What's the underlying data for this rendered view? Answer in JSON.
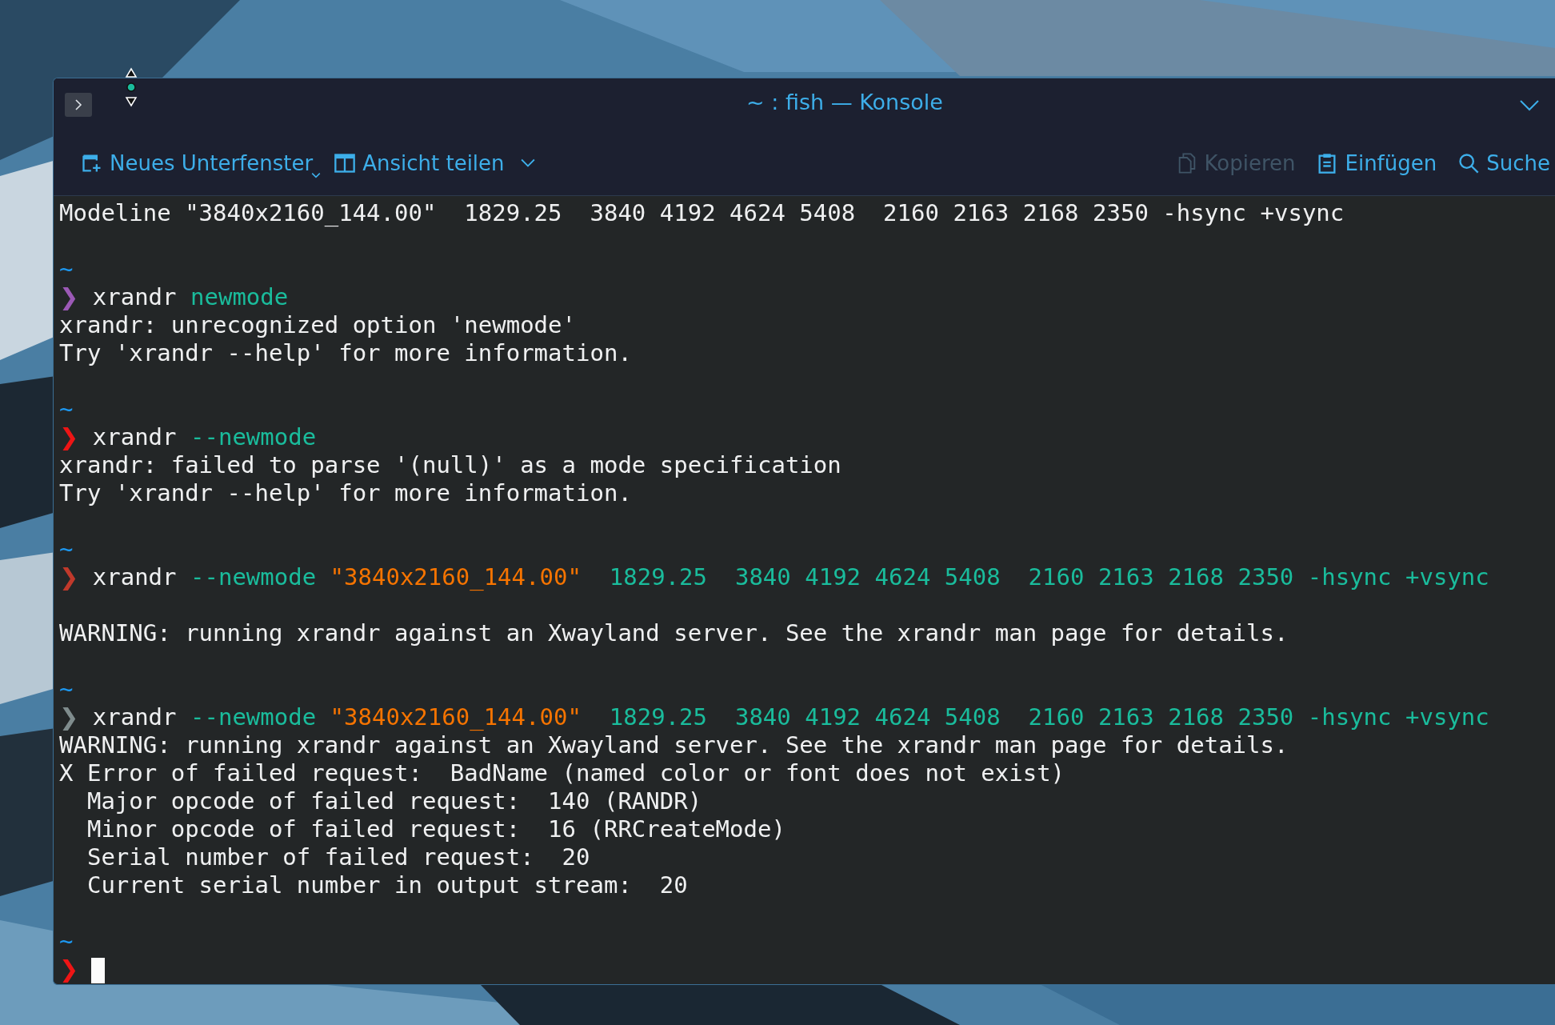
{
  "window": {
    "title": "~ : fish — Konsole"
  },
  "toolbar_left": [
    {
      "kind": "new-tab",
      "label": "Neues Unterfenster",
      "disabled": false,
      "menu": true
    },
    {
      "kind": "split",
      "label": "Ansicht teilen",
      "disabled": false,
      "menu": true
    }
  ],
  "toolbar_right": [
    {
      "kind": "copy",
      "label": "Kopieren",
      "disabled": true
    },
    {
      "kind": "paste",
      "label": "Einfügen",
      "disabled": false
    },
    {
      "kind": "search",
      "label": "Suche",
      "disabled": false
    }
  ],
  "terminal": {
    "lines": [
      {
        "kind": "text",
        "segments": [
          {
            "kind": "plain",
            "text": "Modeline \"3840x2160_144.00\"  1829.25  3840 4192 4624 5408  2160 2163 2168 2350 -hsync +vsync"
          }
        ]
      },
      {
        "kind": "blank"
      },
      {
        "kind": "text",
        "segments": [
          {
            "kind": "tilde",
            "text": "~"
          }
        ]
      },
      {
        "kind": "text",
        "segments": [
          {
            "kind": "prompt",
            "text": "❯",
            "color": "#9b59b6"
          },
          {
            "kind": "plain",
            "text": " xrandr "
          },
          {
            "kind": "arg",
            "text": "newmode"
          }
        ]
      },
      {
        "kind": "text",
        "segments": [
          {
            "kind": "plain",
            "text": "xrandr: unrecognized option 'newmode'"
          }
        ]
      },
      {
        "kind": "text",
        "segments": [
          {
            "kind": "plain",
            "text": "Try 'xrandr --help' for more information."
          }
        ]
      },
      {
        "kind": "blank"
      },
      {
        "kind": "text",
        "segments": [
          {
            "kind": "tilde",
            "text": "~"
          }
        ]
      },
      {
        "kind": "text",
        "segments": [
          {
            "kind": "prompt",
            "text": "❯",
            "color": "#ed1515"
          },
          {
            "kind": "plain",
            "text": " xrandr "
          },
          {
            "kind": "arg",
            "text": "--newmode"
          }
        ]
      },
      {
        "kind": "text",
        "segments": [
          {
            "kind": "plain",
            "text": "xrandr: failed to parse '(null)' as a mode specification"
          }
        ]
      },
      {
        "kind": "text",
        "segments": [
          {
            "kind": "plain",
            "text": "Try 'xrandr --help' for more information."
          }
        ]
      },
      {
        "kind": "blank"
      },
      {
        "kind": "text",
        "segments": [
          {
            "kind": "tilde",
            "text": "~"
          }
        ]
      },
      {
        "kind": "text",
        "segments": [
          {
            "kind": "prompt",
            "text": "❯",
            "color": "#c0392b"
          },
          {
            "kind": "plain",
            "text": " xrandr "
          },
          {
            "kind": "arg",
            "text": "--newmode "
          },
          {
            "kind": "string",
            "text": "\"3840x2160_144.00\""
          },
          {
            "kind": "arg",
            "text": "  1829.25  3840 4192 4624 5408  2160 2163 2168 2350 -hsync +vsync"
          }
        ]
      },
      {
        "kind": "blank"
      },
      {
        "kind": "text",
        "segments": [
          {
            "kind": "plain",
            "text": "WARNING: running xrandr against an Xwayland server. See the xrandr man page for details."
          }
        ]
      },
      {
        "kind": "blank"
      },
      {
        "kind": "text",
        "segments": [
          {
            "kind": "tilde",
            "text": "~"
          }
        ]
      },
      {
        "kind": "text",
        "segments": [
          {
            "kind": "prompt",
            "text": "❯",
            "color": "#7f8c8d"
          },
          {
            "kind": "plain",
            "text": " xrandr "
          },
          {
            "kind": "arg",
            "text": "--newmode "
          },
          {
            "kind": "string",
            "text": "\"3840x2160_144.00\""
          },
          {
            "kind": "arg",
            "text": "  1829.25  3840 4192 4624 5408  2160 2163 2168 2350 -hsync +vsync"
          }
        ]
      },
      {
        "kind": "text",
        "segments": [
          {
            "kind": "plain",
            "text": "WARNING: running xrandr against an Xwayland server. See the xrandr man page for details."
          }
        ]
      },
      {
        "kind": "text",
        "segments": [
          {
            "kind": "plain",
            "text": "X Error of failed request:  BadName (named color or font does not exist)"
          }
        ]
      },
      {
        "kind": "text",
        "segments": [
          {
            "kind": "plain",
            "text": "  Major opcode of failed request:  140 (RANDR)"
          }
        ]
      },
      {
        "kind": "text",
        "segments": [
          {
            "kind": "plain",
            "text": "  Minor opcode of failed request:  16 (RRCreateMode)"
          }
        ]
      },
      {
        "kind": "text",
        "segments": [
          {
            "kind": "plain",
            "text": "  Serial number of failed request:  20"
          }
        ]
      },
      {
        "kind": "text",
        "segments": [
          {
            "kind": "plain",
            "text": "  Current serial number in output stream:  20"
          }
        ]
      },
      {
        "kind": "blank"
      },
      {
        "kind": "text",
        "segments": [
          {
            "kind": "tilde",
            "text": "~"
          }
        ]
      },
      {
        "kind": "text",
        "segments": [
          {
            "kind": "prompt",
            "text": "❯",
            "color": "#ed1515"
          },
          {
            "kind": "cursor"
          }
        ]
      }
    ]
  }
}
